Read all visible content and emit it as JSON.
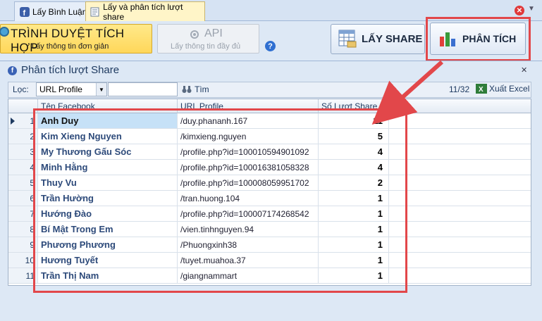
{
  "tabs": [
    {
      "label": "Lấy Bình Luận",
      "icon": "facebook-icon"
    },
    {
      "label": "Lấy và phân tích lượt share",
      "icon": "share-doc-icon"
    }
  ],
  "toolbar": {
    "browser_btn": {
      "title": "TRÌNH DUYỆT TÍCH HỢP",
      "subtitle": "Lấy thông tin đơn giản"
    },
    "api_btn": {
      "title": "API",
      "subtitle": "Lấy thông tin đầy đủ"
    },
    "help": "?",
    "share_btn": "LẤY SHARE",
    "analyze_btn": "PHÂN TÍCH"
  },
  "panel": {
    "title": "Phân tích lượt Share",
    "filter_label": "Lọc:",
    "filter_value": "URL Profile",
    "search_label": "Tìm",
    "pager": "11/32",
    "export_label": "Xuất Excel"
  },
  "table": {
    "columns": [
      "Tên Facebook",
      "URL Profile",
      "Số Lượt Share"
    ],
    "rows": [
      {
        "idx": "1",
        "name": "Anh Duy",
        "url": "/duy.phananh.167",
        "count": "11"
      },
      {
        "idx": "2",
        "name": "Kim Xieng Nguyen",
        "url": "/kimxieng.nguyen",
        "count": "5"
      },
      {
        "idx": "3",
        "name": "My Thương Gấu Sóc",
        "url": "/profile.php?id=100010594901092",
        "count": "4"
      },
      {
        "idx": "4",
        "name": "Minh Hằng",
        "url": "/profile.php?id=100016381058328",
        "count": "4"
      },
      {
        "idx": "5",
        "name": "Thuy Vu",
        "url": "/profile.php?id=100008059951702",
        "count": "2"
      },
      {
        "idx": "6",
        "name": "Trần Hường",
        "url": "/tran.huong.104",
        "count": "1"
      },
      {
        "idx": "7",
        "name": "Hướng Đào",
        "url": "/profile.php?id=100007174268542",
        "count": "1"
      },
      {
        "idx": "8",
        "name": "Bí Mật Trong Em",
        "url": "/vien.tinhnguyen.94",
        "count": "1"
      },
      {
        "idx": "9",
        "name": "Phương Phương",
        "url": "/Phuongxinh38",
        "count": "1"
      },
      {
        "idx": "10",
        "name": "Hương Tuyết",
        "url": "/tuyet.muahoa.37",
        "count": "1"
      },
      {
        "idx": "11",
        "name": "Trần Thị Nam",
        "url": "/giangnammart",
        "count": "1"
      }
    ]
  },
  "colors": {
    "highlight": "#e2474a",
    "name_text": "#2d4a7a",
    "selected_cell": "#c6e1f7"
  }
}
